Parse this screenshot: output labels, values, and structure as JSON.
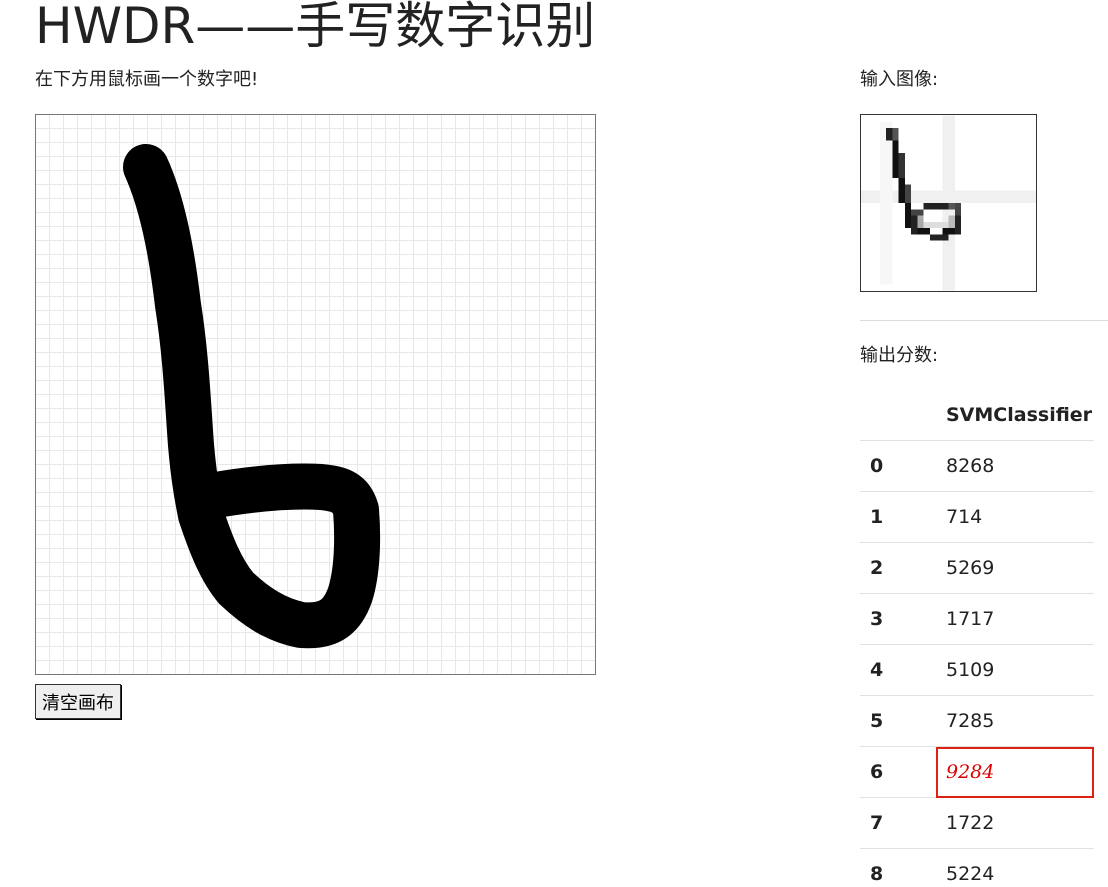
{
  "header": {
    "title": "HWDR——手写数字识别",
    "subtitle": "在下方用鼠标画一个数字吧!"
  },
  "canvas": {
    "clear_button_label": "清空画布"
  },
  "sidebar": {
    "input_label": "输入图像:",
    "output_label": "输出分数:"
  },
  "scores_table": {
    "header": [
      "",
      "SVMClassifier"
    ],
    "rows": [
      {
        "digit": "0",
        "score": "8268"
      },
      {
        "digit": "1",
        "score": "714"
      },
      {
        "digit": "2",
        "score": "5269"
      },
      {
        "digit": "3",
        "score": "1717"
      },
      {
        "digit": "4",
        "score": "5109"
      },
      {
        "digit": "5",
        "score": "7285"
      },
      {
        "digit": "6",
        "score": "9284"
      },
      {
        "digit": "7",
        "score": "1722"
      },
      {
        "digit": "8",
        "score": "5224"
      }
    ],
    "highlight_digit": "6",
    "highlight_color": "#dd1111"
  }
}
